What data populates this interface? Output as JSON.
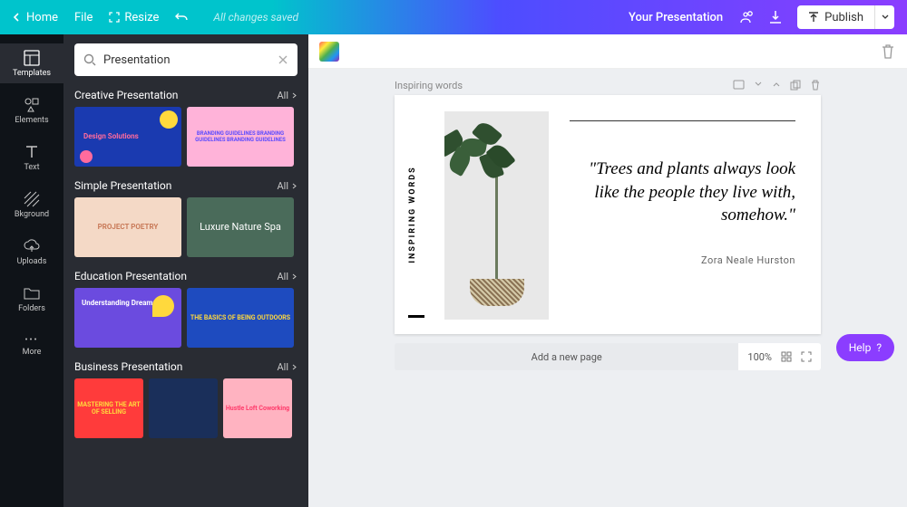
{
  "topbar": {
    "home": "Home",
    "file": "File",
    "resize": "Resize",
    "save_status": "All changes saved",
    "doc_title": "Your Presentation",
    "publish": "Publish"
  },
  "rail": {
    "templates": "Templates",
    "elements": "Elements",
    "text": "Text",
    "background": "Bkground",
    "uploads": "Uploads",
    "folders": "Folders",
    "more": "More"
  },
  "search": {
    "value": "Presentation"
  },
  "sections": {
    "creative": {
      "title": "Creative Presentation",
      "all": "All",
      "t1": "Design Solutions",
      "t2": "BRANDING GUIDELINES BRANDING GUIDELINES BRANDING GUIDELINES"
    },
    "simple": {
      "title": "Simple Presentation",
      "all": "All",
      "t1": "PROJECT POETRY",
      "t2": "Luxure Nature Spa"
    },
    "education": {
      "title": "Education Presentation",
      "all": "All",
      "t1": "Understanding Dreams",
      "t2": "THE BASICS OF BEING OUTDOORS"
    },
    "business": {
      "title": "Business Presentation",
      "all": "All",
      "t1": "MASTERING THE ART OF SELLING",
      "t2": "",
      "t3": "Hustle Loft Coworking"
    }
  },
  "canvas": {
    "slide_title": "Inspiring words",
    "rotated_label": "INSPIRING WORDS",
    "quote": "\"Trees and plants always look like the people they live with, somehow.\"",
    "author": "Zora Neale Hurston",
    "add_page": "Add a new page",
    "zoom": "100%",
    "help": "Help"
  }
}
